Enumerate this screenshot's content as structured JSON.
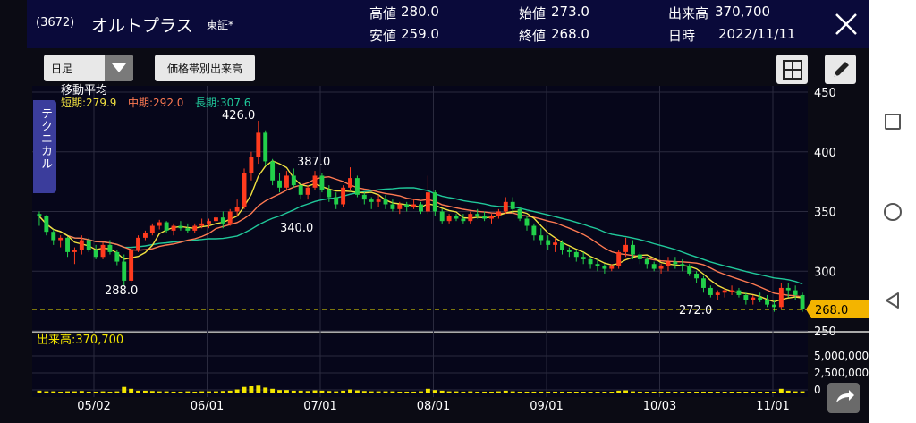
{
  "header": {
    "code": "(3672)",
    "name": "オルトプラス",
    "market": "東証*",
    "high_label": "高値",
    "high_value": "280.0",
    "low_label": "安値",
    "low_value": "259.0",
    "open_label": "始値",
    "open_value": "273.0",
    "close_label": "終値",
    "close_value": "268.0",
    "volume_label": "出来高",
    "volume_value": "370,700",
    "date_label": "日時",
    "date_value": "2022/11/11"
  },
  "toolbar": {
    "period_select": "日足",
    "volume_by_price_button": "価格帯別出来高"
  },
  "side_tab": {
    "label": "テクニカル"
  },
  "ma_legend": {
    "title": "移動平均",
    "short": "短期:279.9",
    "mid": "中期:292.0",
    "long": "長期:307.6"
  },
  "volume_label": "出来高:370,700",
  "price_tag": "268.0",
  "colors": {
    "up": "#ff3b1e",
    "down": "#22d04a",
    "short_ma": "#f0e040",
    "mid_ma": "#ff7a52",
    "long_ma": "#20c89a",
    "volume": "#f3e600",
    "header_bg": "#0a0a3a"
  },
  "icons": {
    "close": "close-icon",
    "dropdown": "chevron-down-icon",
    "grid": "grid-layout-icon",
    "pencil": "pencil-icon",
    "share": "share-icon",
    "nav_recent": "square-icon",
    "nav_home": "circle-icon",
    "nav_back": "triangle-back-icon"
  },
  "chart_data": {
    "type": "candlestick",
    "y_ticks": [
      "450",
      "400",
      "350",
      "300",
      "250"
    ],
    "ylim": [
      250,
      450
    ],
    "volume_ticks": [
      "5,000,000",
      "2,500,000",
      "0"
    ],
    "x_ticks": [
      "05/02",
      "06/01",
      "07/01",
      "08/01",
      "09/01",
      "10/03",
      "11/01"
    ],
    "annotations": [
      "426.0",
      "387.0",
      "340.0",
      "288.0",
      "272.0"
    ],
    "last_close": 268.0,
    "grid": true,
    "ohlc": [
      [
        348,
        350,
        338,
        346
      ],
      [
        346,
        347,
        330,
        333
      ],
      [
        333,
        335,
        322,
        326
      ],
      [
        326,
        330,
        320,
        328
      ],
      [
        328,
        329,
        312,
        316
      ],
      [
        316,
        320,
        306,
        318
      ],
      [
        318,
        330,
        314,
        326
      ],
      [
        326,
        328,
        316,
        318
      ],
      [
        318,
        322,
        310,
        312
      ],
      [
        312,
        324,
        310,
        322
      ],
      [
        322,
        326,
        314,
        316
      ],
      [
        316,
        318,
        305,
        308
      ],
      [
        308,
        314,
        288,
        292
      ],
      [
        292,
        320,
        290,
        318
      ],
      [
        318,
        330,
        316,
        328
      ],
      [
        328,
        334,
        326,
        332
      ],
      [
        332,
        340,
        330,
        338
      ],
      [
        338,
        343,
        335,
        341
      ],
      [
        341,
        342,
        332,
        334
      ],
      [
        334,
        340,
        330,
        338
      ],
      [
        338,
        342,
        334,
        336
      ],
      [
        336,
        340,
        332,
        334
      ],
      [
        334,
        340,
        332,
        338
      ],
      [
        338,
        344,
        336,
        340
      ],
      [
        340,
        344,
        336,
        342
      ],
      [
        342,
        346,
        340,
        345
      ],
      [
        345,
        350,
        336,
        340
      ],
      [
        340,
        352,
        338,
        350
      ],
      [
        350,
        360,
        346,
        354
      ],
      [
        354,
        386,
        352,
        382
      ],
      [
        382,
        400,
        376,
        396
      ],
      [
        396,
        426,
        390,
        416
      ],
      [
        416,
        418,
        388,
        392
      ],
      [
        392,
        394,
        372,
        376
      ],
      [
        376,
        382,
        366,
        370
      ],
      [
        370,
        384,
        368,
        380
      ],
      [
        380,
        386,
        370,
        372
      ],
      [
        372,
        374,
        360,
        364
      ],
      [
        364,
        372,
        360,
        370
      ],
      [
        370,
        384,
        368,
        380
      ],
      [
        380,
        382,
        366,
        368
      ],
      [
        368,
        372,
        358,
        362
      ],
      [
        362,
        366,
        352,
        356
      ],
      [
        356,
        372,
        354,
        370
      ],
      [
        370,
        387,
        368,
        378
      ],
      [
        378,
        380,
        362,
        364
      ],
      [
        364,
        366,
        356,
        360
      ],
      [
        360,
        362,
        352,
        358
      ],
      [
        358,
        364,
        354,
        360
      ],
      [
        360,
        364,
        352,
        356
      ],
      [
        356,
        360,
        350,
        352
      ],
      [
        352,
        358,
        348,
        356
      ],
      [
        356,
        358,
        350,
        354
      ],
      [
        354,
        360,
        352,
        356
      ],
      [
        356,
        358,
        348,
        350
      ],
      [
        350,
        380,
        348,
        366
      ],
      [
        366,
        368,
        346,
        350
      ],
      [
        350,
        352,
        340,
        342
      ],
      [
        342,
        348,
        340,
        346
      ],
      [
        346,
        348,
        342,
        344
      ],
      [
        344,
        348,
        340,
        342
      ],
      [
        342,
        350,
        340,
        348
      ],
      [
        348,
        352,
        344,
        346
      ],
      [
        346,
        350,
        342,
        344
      ],
      [
        344,
        348,
        340,
        346
      ],
      [
        346,
        352,
        344,
        350
      ],
      [
        350,
        362,
        348,
        358
      ],
      [
        358,
        362,
        348,
        352
      ],
      [
        352,
        354,
        342,
        344
      ],
      [
        344,
        346,
        334,
        338
      ],
      [
        338,
        340,
        326,
        330
      ],
      [
        330,
        336,
        322,
        326
      ],
      [
        326,
        330,
        318,
        322
      ],
      [
        322,
        328,
        316,
        324
      ],
      [
        324,
        326,
        314,
        318
      ],
      [
        318,
        320,
        312,
        316
      ],
      [
        316,
        318,
        308,
        312
      ],
      [
        312,
        316,
        306,
        310
      ],
      [
        310,
        312,
        302,
        306
      ],
      [
        306,
        310,
        300,
        304
      ],
      [
        304,
        306,
        298,
        302
      ],
      [
        302,
        306,
        300,
        304
      ],
      [
        304,
        318,
        302,
        316
      ],
      [
        316,
        328,
        312,
        322
      ],
      [
        322,
        326,
        310,
        314
      ],
      [
        314,
        316,
        306,
        310
      ],
      [
        310,
        312,
        302,
        306
      ],
      [
        306,
        308,
        300,
        302
      ],
      [
        302,
        306,
        298,
        304
      ],
      [
        304,
        312,
        300,
        308
      ],
      [
        308,
        312,
        302,
        306
      ],
      [
        306,
        310,
        300,
        304
      ],
      [
        304,
        306,
        296,
        298
      ],
      [
        298,
        300,
        290,
        294
      ],
      [
        294,
        296,
        282,
        286
      ],
      [
        286,
        288,
        278,
        280
      ],
      [
        280,
        284,
        276,
        282
      ],
      [
        282,
        286,
        278,
        284
      ],
      [
        284,
        288,
        280,
        284
      ],
      [
        284,
        286,
        278,
        280
      ],
      [
        280,
        282,
        272,
        276
      ],
      [
        276,
        280,
        272,
        278
      ],
      [
        278,
        282,
        274,
        276
      ],
      [
        276,
        280,
        270,
        272
      ],
      [
        272,
        276,
        266,
        270
      ],
      [
        270,
        290,
        268,
        286
      ],
      [
        286,
        290,
        278,
        284
      ],
      [
        284,
        288,
        276,
        280
      ],
      [
        280,
        282,
        266,
        268
      ]
    ],
    "volume": [
      0.3,
      0.2,
      0.2,
      0.15,
      0.2,
      0.2,
      0.25,
      0.15,
      0.15,
      0.2,
      0.15,
      0.2,
      0.9,
      0.6,
      0.3,
      0.3,
      0.25,
      0.2,
      0.2,
      0.15,
      0.15,
      0.2,
      0.15,
      0.2,
      0.2,
      0.2,
      0.25,
      0.3,
      0.5,
      0.9,
      1.0,
      1.1,
      0.8,
      0.6,
      0.4,
      0.4,
      0.3,
      0.3,
      0.25,
      0.35,
      0.3,
      0.25,
      0.2,
      0.3,
      0.5,
      0.35,
      0.25,
      0.2,
      0.2,
      0.2,
      0.2,
      0.15,
      0.15,
      0.15,
      0.2,
      0.6,
      0.4,
      0.3,
      0.2,
      0.2,
      0.15,
      0.2,
      0.15,
      0.15,
      0.15,
      0.2,
      0.3,
      0.2,
      0.15,
      0.15,
      0.15,
      0.15,
      0.15,
      0.15,
      0.15,
      0.1,
      0.1,
      0.1,
      0.1,
      0.1,
      0.1,
      0.1,
      0.3,
      0.35,
      0.2,
      0.15,
      0.1,
      0.1,
      0.1,
      0.15,
      0.1,
      0.1,
      0.1,
      0.1,
      0.15,
      0.1,
      0.1,
      0.1,
      0.1,
      0.1,
      0.1,
      0.1,
      0.1,
      0.1,
      0.1,
      0.6,
      0.3,
      0.2,
      0.2
    ]
  }
}
